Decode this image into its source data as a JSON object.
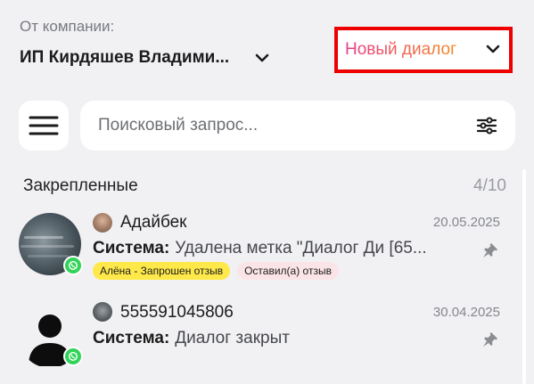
{
  "company": {
    "label": "От компании:",
    "name": "ИП Кирдяшев Владими..."
  },
  "new_dialog": {
    "label": "Новый диалог",
    "highlight_color": "#ee0000"
  },
  "search": {
    "placeholder": "Поисковый запрос..."
  },
  "pinned": {
    "title": "Закрепленные",
    "count": "4/10"
  },
  "chats": [
    {
      "name": "Адайбек",
      "date": "20.05.2025",
      "sender": "Система:",
      "message": "Удалена метка \"Диалог Ди [65...",
      "tags": [
        "Алёна - Запрошен отзыв",
        "Оставил(а) отзыв"
      ],
      "channel_icon": "whatsapp-icon",
      "pinned": true
    },
    {
      "name": "555591045806",
      "date": "30.04.2025",
      "sender": "Система:",
      "message": "Диалог закрыт",
      "tags": [],
      "channel_icon": "whatsapp-icon",
      "pinned": true
    }
  ],
  "colors": {
    "background": "#f1f1f4",
    "whatsapp": "#33d35a",
    "tag_yellow": "#ffe94a",
    "tag_pink": "#fbe4e8"
  }
}
